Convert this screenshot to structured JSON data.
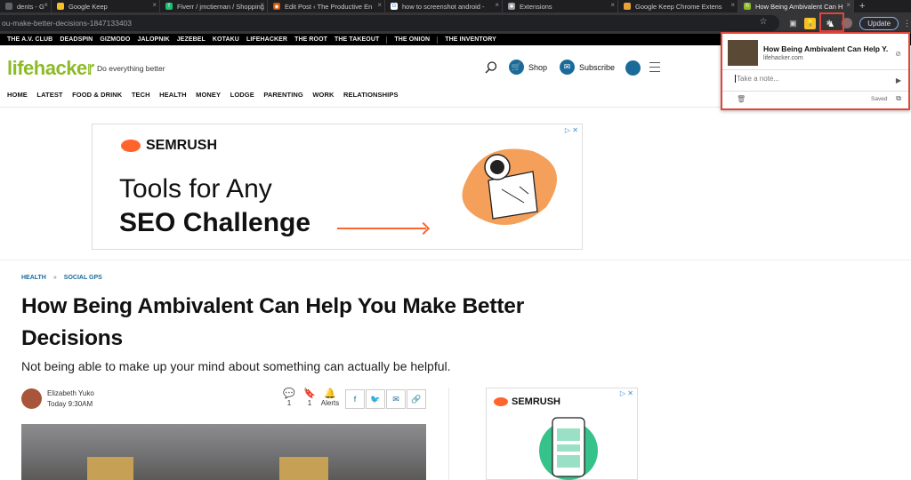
{
  "browser": {
    "tabs": [
      {
        "label": "dents - G",
        "color": "#5f6368",
        "glyph": ""
      },
      {
        "label": "Google Keep",
        "color": "#f6c026",
        "glyph": ""
      },
      {
        "label": "Fiverr / jmctiernan / Shopping",
        "color": "#1dbf73",
        "glyph": "f"
      },
      {
        "label": "Edit Post ‹ The Productive En",
        "color": "#d35400",
        "glyph": "◉"
      },
      {
        "label": "how to screenshot android - ",
        "color": "#ffffff",
        "glyph": "G"
      },
      {
        "label": "Extensions",
        "color": "#9aa0a6",
        "glyph": "✱"
      },
      {
        "label": "Google Keep Chrome Extens",
        "color": "#e8a23a",
        "glyph": ""
      },
      {
        "label": "How Being Ambivalent Can H",
        "color": "#8cbb28",
        "glyph": "h"
      }
    ],
    "new_tab": "+",
    "url": "ou-make-better-decisions-1847133403",
    "update_label": "Update"
  },
  "network": [
    "THE A.V. CLUB",
    "DEADSPIN",
    "GIZMODO",
    "JALOPNIK",
    "JEZEBEL",
    "KOTAKU",
    "LIFEHACKER",
    "THE ROOT",
    "THE TAKEOUT",
    "THE ONION",
    "THE INVENTORY"
  ],
  "site": {
    "logo": "lifehacker",
    "tagline": "Do everything better",
    "shop_label": "Shop",
    "subscribe_label": "Subscribe",
    "nav": [
      "HOME",
      "LATEST",
      "FOOD & DRINK",
      "TECH",
      "HEALTH",
      "MONEY",
      "LODGE",
      "PARENTING",
      "WORK",
      "RELATIONSHIPS"
    ]
  },
  "ad1": {
    "brand": "SEMRUSH",
    "line1": "Tools for Any",
    "line2": "SEO Challenge",
    "adchoices": "▷ ✕"
  },
  "article": {
    "crumb1": "HEALTH",
    "crumb_sep": "»",
    "crumb2": "SOCIAL GPS",
    "title": "How Being Ambivalent Can Help You Make Better Decisions",
    "subtitle": "Not being able to make up your mind about something can actually be helpful.",
    "author": "Elizabeth Yuko",
    "date": "Today 9:30AM",
    "comments": "1",
    "bookmarks": "1",
    "alerts": "Alerts"
  },
  "ad2": {
    "brand": "SEMRUSH",
    "adchoices": "▷ ✕"
  },
  "keep": {
    "title": "How Being Ambivalent Can Help Y...",
    "domain": "lifehacker.com",
    "placeholder": "Take a note...",
    "saved": "Saved"
  },
  "colors": {
    "accent": "#1a6b9a",
    "brand_green": "#8cbb28",
    "semrush_orange": "#ff642d",
    "highlight_red": "#e0463a"
  }
}
